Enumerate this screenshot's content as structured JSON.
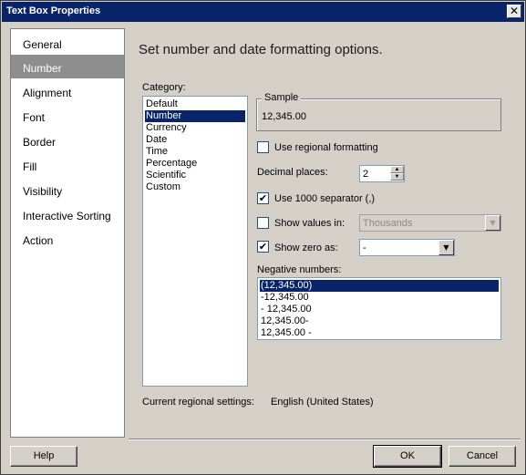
{
  "window": {
    "title": "Text Box Properties"
  },
  "nav": {
    "items": [
      {
        "label": "General"
      },
      {
        "label": "Number"
      },
      {
        "label": "Alignment"
      },
      {
        "label": "Font"
      },
      {
        "label": "Border"
      },
      {
        "label": "Fill"
      },
      {
        "label": "Visibility"
      },
      {
        "label": "Interactive Sorting"
      },
      {
        "label": "Action"
      }
    ],
    "selected": "Number"
  },
  "main": {
    "heading": "Set number and date formatting options.",
    "category_label": "Category:",
    "categories": [
      "Default",
      "Number",
      "Currency",
      "Date",
      "Time",
      "Percentage",
      "Scientific",
      "Custom"
    ],
    "selected_category": "Number",
    "sample_label": "Sample",
    "sample_value": "12,345.00",
    "use_regional_label": "Use regional formatting",
    "use_regional_checked": false,
    "decimal_places_label": "Decimal places:",
    "decimal_places_value": "2",
    "use_separator_label": "Use 1000 separator (,)",
    "use_separator_checked": true,
    "show_values_in_label": "Show values in:",
    "show_values_in_checked": false,
    "show_values_in_value": "Thousands",
    "show_zero_label": "Show zero as:",
    "show_zero_checked": true,
    "show_zero_value": "-",
    "negative_label": "Negative numbers:",
    "negative_options": [
      "(12,345.00)",
      "-12,345.00",
      "- 12,345.00",
      "12,345.00-",
      "12,345.00 -"
    ],
    "negative_selected": "(12,345.00)",
    "regional_settings_label": "Current regional settings:",
    "regional_settings_value": "English (United States)"
  },
  "footer": {
    "help_label": "Help",
    "ok_label": "OK",
    "cancel_label": "Cancel"
  },
  "colors": {
    "titlebar": "#0a246a",
    "selection": "#0a246a",
    "nav_selected": "#8e8e8e",
    "dialog_bg": "#d4d0c8"
  }
}
